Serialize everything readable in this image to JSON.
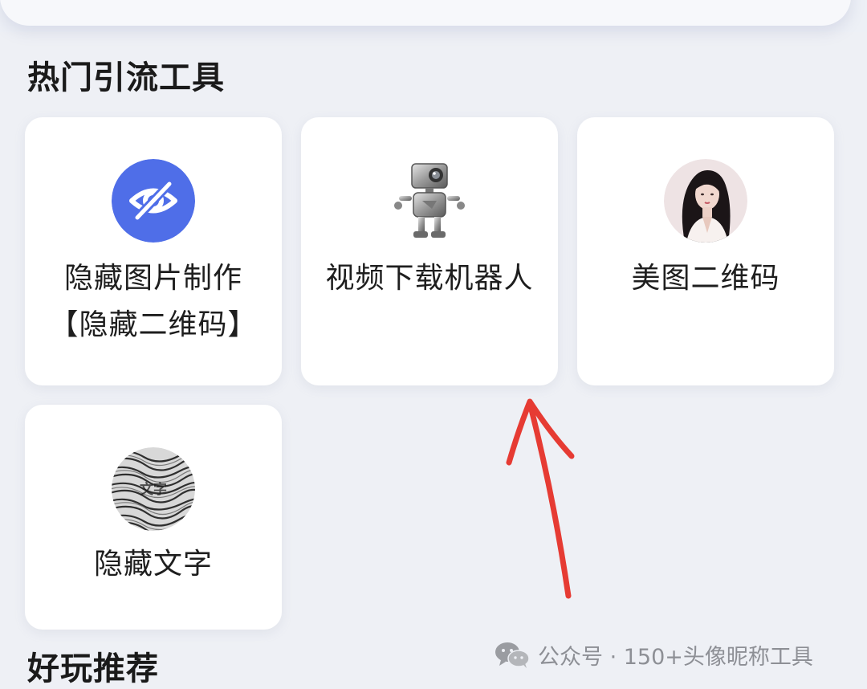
{
  "sections": {
    "hot_tools_title": "热门引流工具",
    "fun_recommend_title": "好玩推荐"
  },
  "tools": [
    {
      "label_line1": "隐藏图片制作",
      "label_line2": "【隐藏二维码】",
      "icon": "hidden-eye-icon",
      "icon_color": "#4f6ee8"
    },
    {
      "label_line1": "视频下载机器人",
      "icon": "robot-camera-icon"
    },
    {
      "label_line1": "美图二维码",
      "icon": "portrait-avatar-icon"
    },
    {
      "label_line1": "隐藏文字",
      "icon": "hidden-text-icon",
      "icon_text": "文字"
    }
  ],
  "watermark": {
    "text": "公众号 · 150+头像昵称工具",
    "icon": "wechat-icon"
  },
  "annotation": {
    "arrow_color": "#e63b33"
  }
}
